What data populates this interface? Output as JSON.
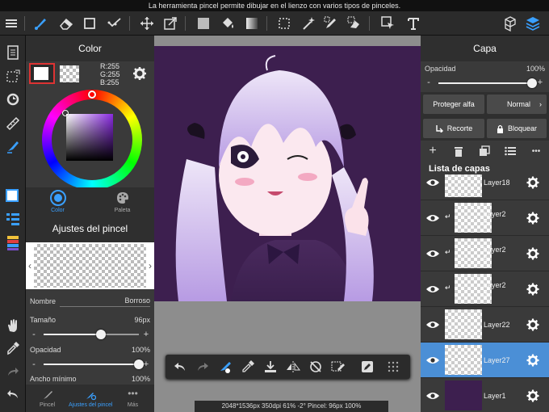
{
  "hint": "La herramienta pincel permite dibujar en el lienzo con varios tipos de pinceles.",
  "color_panel": {
    "title": "Color",
    "rgb": [
      "R:255",
      "G:255",
      "B:255"
    ],
    "tabs": [
      {
        "label": "Color"
      },
      {
        "label": "Paleta"
      }
    ]
  },
  "brush_panel": {
    "title": "Ajustes del pincel",
    "name_label": "Nombre",
    "name_value": "Borroso",
    "size_label": "Tamaño",
    "size_value": "96px",
    "size_level": 0.6,
    "opacity_label": "Opacidad",
    "opacity_value": "100%",
    "opacity_level": 1.0,
    "min_width_label": "Ancho mínimo",
    "min_width_value": "100%",
    "tabs": [
      {
        "label": "Pincel"
      },
      {
        "label": "Ajustes del pincel"
      },
      {
        "label": "Más"
      }
    ]
  },
  "status_bar": "2048*1536px 350dpi 61% -2° Pincel: 96px 100%",
  "layer_panel": {
    "title": "Capa",
    "opacity_label": "Opacidad",
    "opacity_value": "100%",
    "opacity_level": 1.0,
    "protect_alpha": "Proteger alfa",
    "blend_mode": "Normal",
    "clipping": "Recorte",
    "lock": "Bloquear",
    "list_title": "Lista de capas",
    "layers": [
      {
        "name": "Layer18",
        "clip": false,
        "selected": false
      },
      {
        "name": "Layer2\n5",
        "clip": true,
        "selected": false
      },
      {
        "name": "Layer2\n4",
        "clip": true,
        "selected": false
      },
      {
        "name": "Layer2\n3",
        "clip": true,
        "selected": false
      },
      {
        "name": "Layer22",
        "clip": false,
        "selected": false
      },
      {
        "name": "Layer27",
        "clip": false,
        "selected": true
      },
      {
        "name": "Layer1",
        "clip": false,
        "selected": false
      }
    ]
  },
  "colors": {
    "accent": "#4b8fd6",
    "canvas_bg": "#3d1f4f",
    "selected_layer": "#4b8fd6",
    "active_tool": "#3aa0ff"
  }
}
